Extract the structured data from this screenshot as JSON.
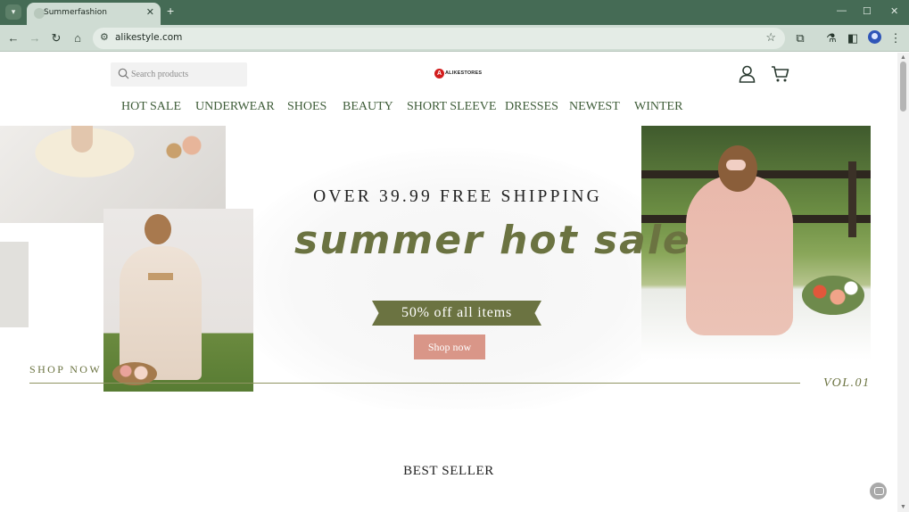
{
  "browser": {
    "tab_title": "Summerfashion",
    "tab_close": "✕",
    "new_tab": "+",
    "url": "alikestyle.com",
    "tab_menu_icon": "chevron-down-icon",
    "window_controls": {
      "minimize": "—",
      "maximize": "☐",
      "close": "✕"
    }
  },
  "header": {
    "search_placeholder": "Search products",
    "logo_mark": "A",
    "logo_text": "ALIKESTORES"
  },
  "nav": {
    "items": [
      "HOT SALE",
      "UNDERWEAR",
      "SHOES",
      "BEAUTY",
      "SHORT SLEEVE",
      "DRESSES",
      "NEWEST",
      "WINTER"
    ]
  },
  "banner": {
    "shipping": "OVER 39.99 FREE SHIPPING",
    "headline": "summer hot sale",
    "discount": "50% off all items",
    "button": "Shop now",
    "shop_link": "SHOP NOW",
    "volume": "VOL.01"
  },
  "section": {
    "title": "BEST SELLER"
  },
  "colors": {
    "chrome_dark": "#456b55",
    "chrome_light": "#cfdcd3",
    "nav_text": "#3e5c38",
    "olive_accent": "#6b7341",
    "button_pink": "#d99688"
  }
}
